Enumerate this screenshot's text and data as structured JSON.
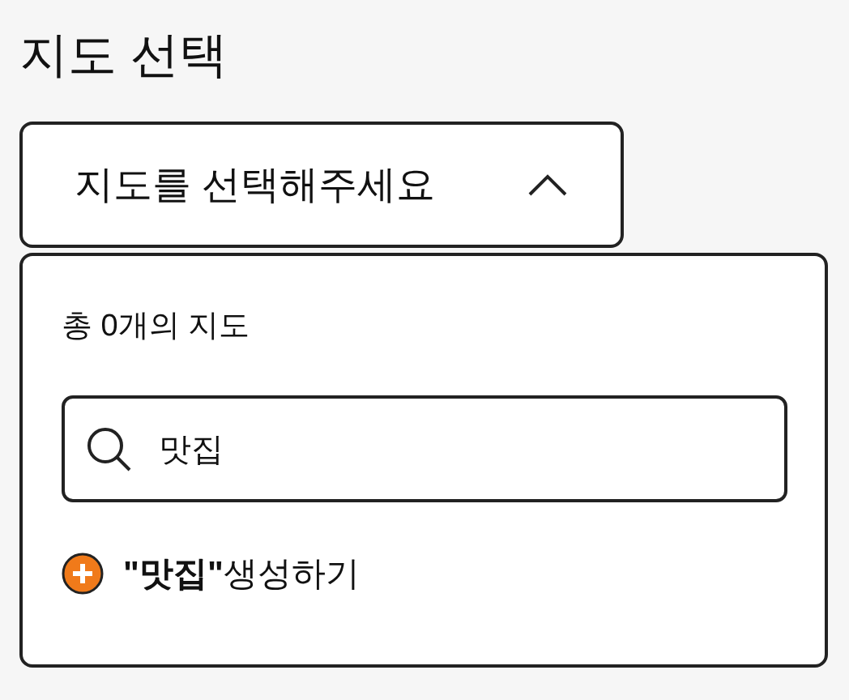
{
  "title": "지도 선택",
  "dropdown": {
    "placeholder": "지도를 선택해주세요",
    "expanded": true
  },
  "panel": {
    "count": "총 0개의 지도",
    "search": {
      "value": "맛집"
    },
    "create": "**\"맛집\"**생성하기"
  }
}
